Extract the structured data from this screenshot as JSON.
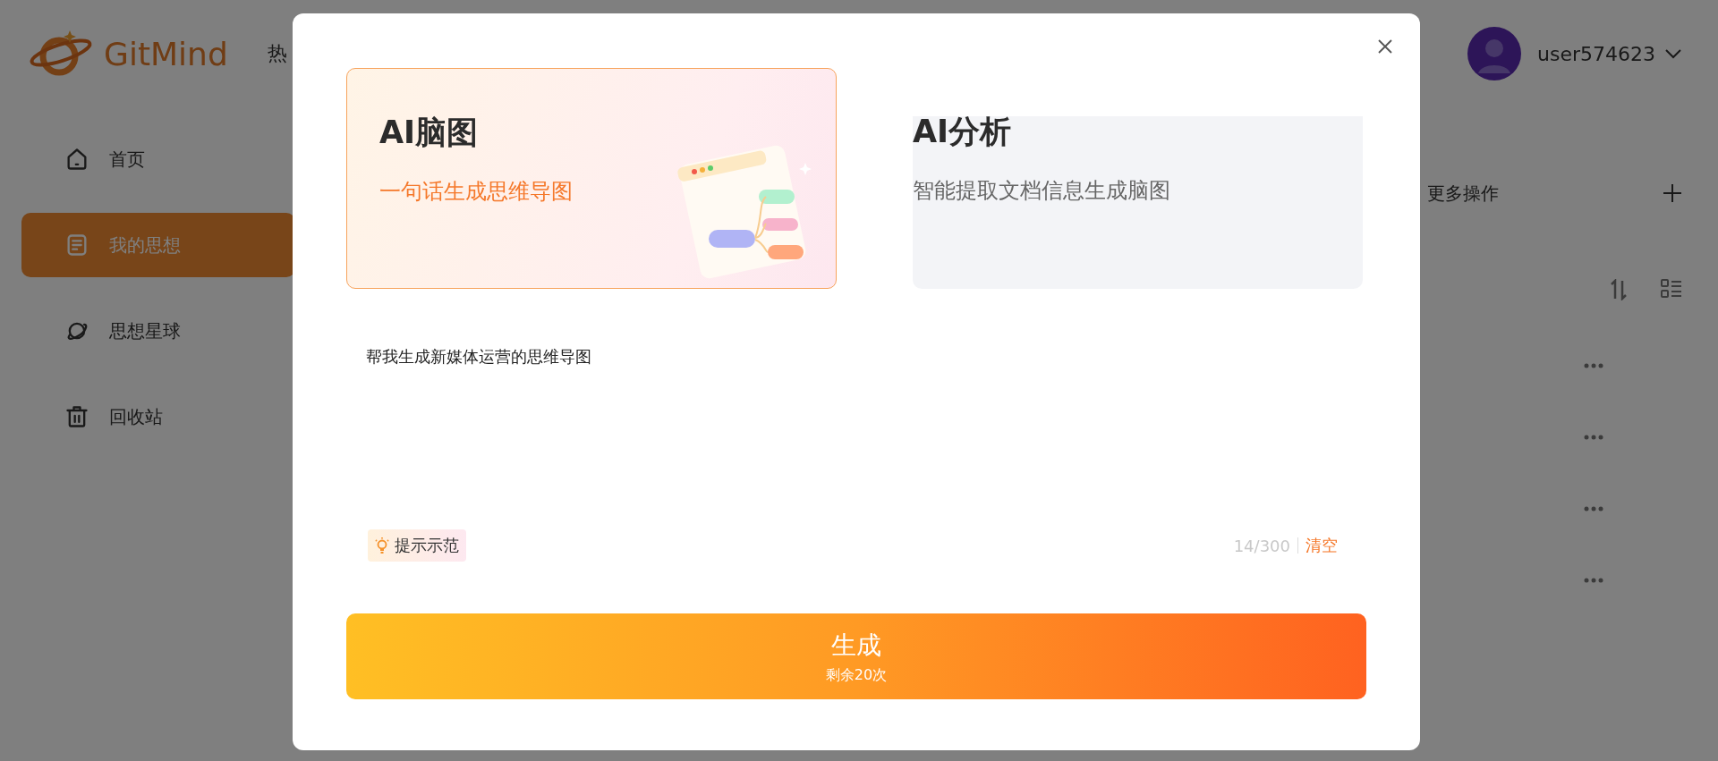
{
  "header": {
    "logo": "GitMind",
    "nav_left": "热",
    "user": "user574623"
  },
  "sidebar": {
    "items": [
      {
        "label": "首页",
        "kind": "home",
        "selected": false
      },
      {
        "label": "我的思想",
        "kind": "doc",
        "selected": true
      },
      {
        "label": "思想星球",
        "kind": "planet",
        "selected": false
      },
      {
        "label": "回收站",
        "kind": "trash",
        "selected": false
      }
    ]
  },
  "content": {
    "more_actions": "更多操作"
  },
  "dialog": {
    "modes": [
      {
        "title": "AI脑图",
        "subtitle": "一句话生成思维导图",
        "selected": true
      },
      {
        "title": "AI分析",
        "subtitle": "智能提取文档信息生成脑图",
        "selected": false
      }
    ],
    "prompt": "帮我生成新媒体运营的思维导图",
    "hint_button": "提示示范",
    "counter": "14/300",
    "clear": "清空",
    "generate": {
      "label": "生成",
      "remaining": "剩余20次"
    }
  }
}
